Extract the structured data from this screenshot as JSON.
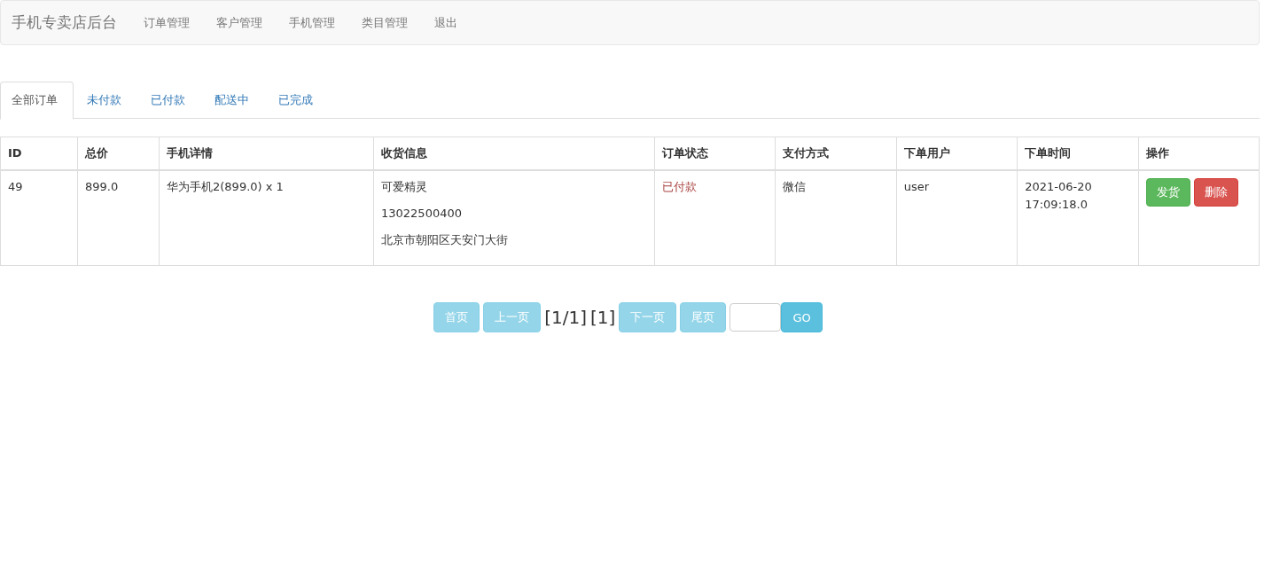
{
  "navbar": {
    "brand": "手机专卖店后台",
    "items": [
      "订单管理",
      "客户管理",
      "手机管理",
      "类目管理",
      "退出"
    ]
  },
  "tabs": [
    {
      "label": "全部订单",
      "selected": true
    },
    {
      "label": "未付款",
      "selected": false
    },
    {
      "label": "已付款",
      "selected": false
    },
    {
      "label": "配送中",
      "selected": false
    },
    {
      "label": "已完成",
      "selected": false
    }
  ],
  "table": {
    "columns": [
      "ID",
      "总价",
      "手机详情",
      "收货信息",
      "订单状态",
      "支付方式",
      "下单用户",
      "下单时间",
      "操作"
    ],
    "rows": [
      {
        "id": "49",
        "total": "899.0",
        "phone_detail": "华为手机2(899.0) x 1",
        "shipping": [
          "可爱精灵",
          "13022500400",
          "北京市朝阳区天安门大街"
        ],
        "status": "已付款",
        "payment": "微信",
        "user": "user",
        "time": [
          "2021-06-20",
          "17:09:18.0"
        ],
        "actions": [
          {
            "label": "发货",
            "kind": "success"
          },
          {
            "label": "删除",
            "kind": "danger"
          }
        ]
      }
    ]
  },
  "pager": [
    {
      "kind": "button",
      "label": "首页",
      "disabled": true
    },
    {
      "kind": "button",
      "label": "上一页",
      "disabled": true
    },
    {
      "kind": "text",
      "label": "[1/1]"
    },
    {
      "kind": "text",
      "label": "[1]"
    },
    {
      "kind": "button",
      "label": "下一页",
      "disabled": true
    },
    {
      "kind": "button",
      "label": "尾页",
      "disabled": true
    },
    {
      "kind": "input"
    },
    {
      "kind": "button",
      "label": "GO",
      "disabled": false
    }
  ]
}
